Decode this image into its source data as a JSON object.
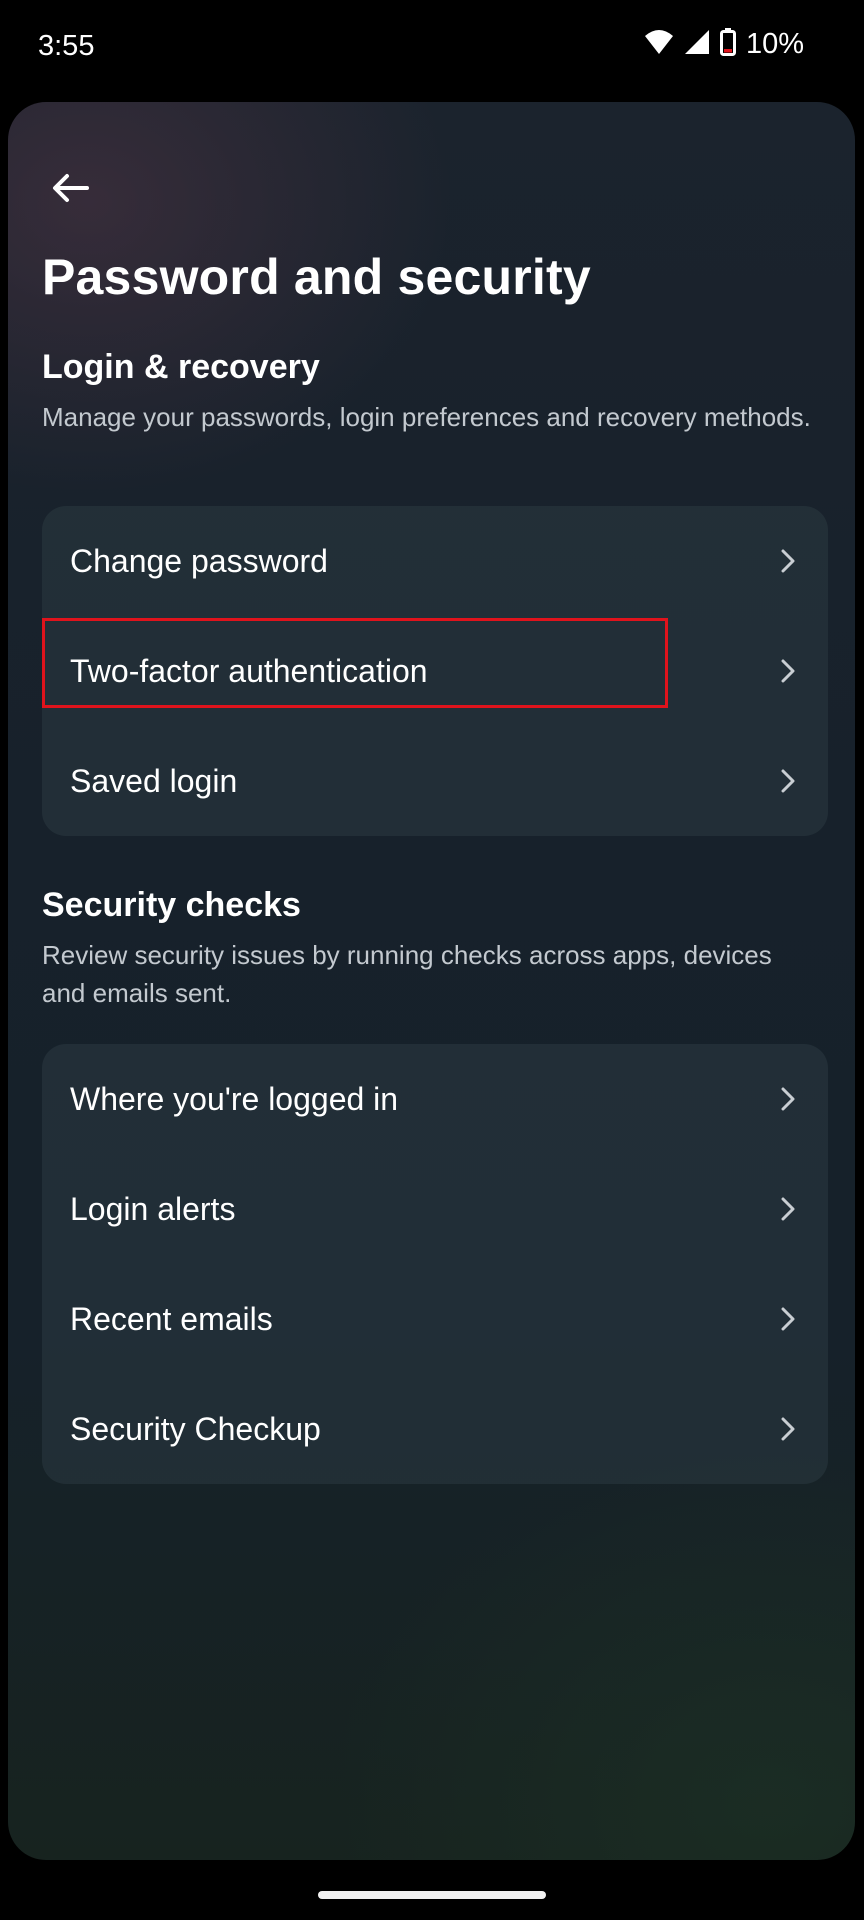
{
  "status_bar": {
    "time": "3:55",
    "battery": "10%",
    "icons": [
      "wifi-icon",
      "cellular-signal-icon",
      "battery-low-icon"
    ]
  },
  "header": {
    "back_icon": "arrow-left-icon",
    "title": "Password and security"
  },
  "login_recovery": {
    "title": "Login & recovery",
    "description": "Manage your passwords, login preferences and recovery methods.",
    "items": [
      {
        "label": "Change password"
      },
      {
        "label": "Two-factor authentication"
      },
      {
        "label": "Saved login"
      }
    ]
  },
  "security_checks": {
    "title": "Security checks",
    "description": "Review security issues by running checks across apps, devices and emails sent.",
    "items": [
      {
        "label": "Where you're logged in"
      },
      {
        "label": "Login alerts"
      },
      {
        "label": "Recent emails"
      },
      {
        "label": "Security Checkup"
      }
    ]
  },
  "colors": {
    "background": "#000000",
    "sheet": "#17212b",
    "card": "#243039",
    "highlight": "#e0131c",
    "text_primary": "#ffffff",
    "text_secondary": "#c3c9cf"
  }
}
